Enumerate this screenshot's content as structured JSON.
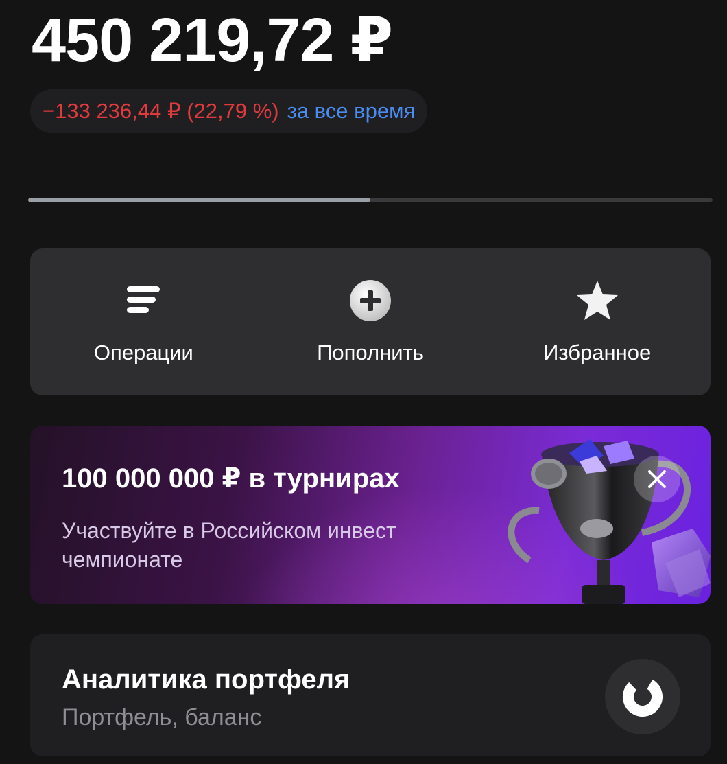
{
  "portfolio": {
    "balance": "450 219,72 ₽",
    "change_amount": "−133 236,44 ₽ (22,79 %)",
    "change_period": "за все время",
    "pager_progress": 0.5
  },
  "actions": [
    {
      "label": "Операции",
      "icon": "operations-icon"
    },
    {
      "label": "Пополнить",
      "icon": "plus-circle-icon"
    },
    {
      "label": "Избранное",
      "icon": "star-icon"
    }
  ],
  "promo": {
    "title": "100 000 000 ₽ в турнирах",
    "subtitle": "Участвуйте в Российском инвест чемпионате",
    "image": "trophy-illustration",
    "close_icon": "close-icon"
  },
  "analytics": {
    "title": "Аналитика портфеля",
    "subtitle": "Портфель, баланс",
    "icon": "donut-chart-icon"
  },
  "colors": {
    "background": "#141415",
    "card": "#2e2e30",
    "negative": "#e03a3e",
    "link": "#4a8cf0",
    "promo_accent": "#7b2bd6"
  }
}
